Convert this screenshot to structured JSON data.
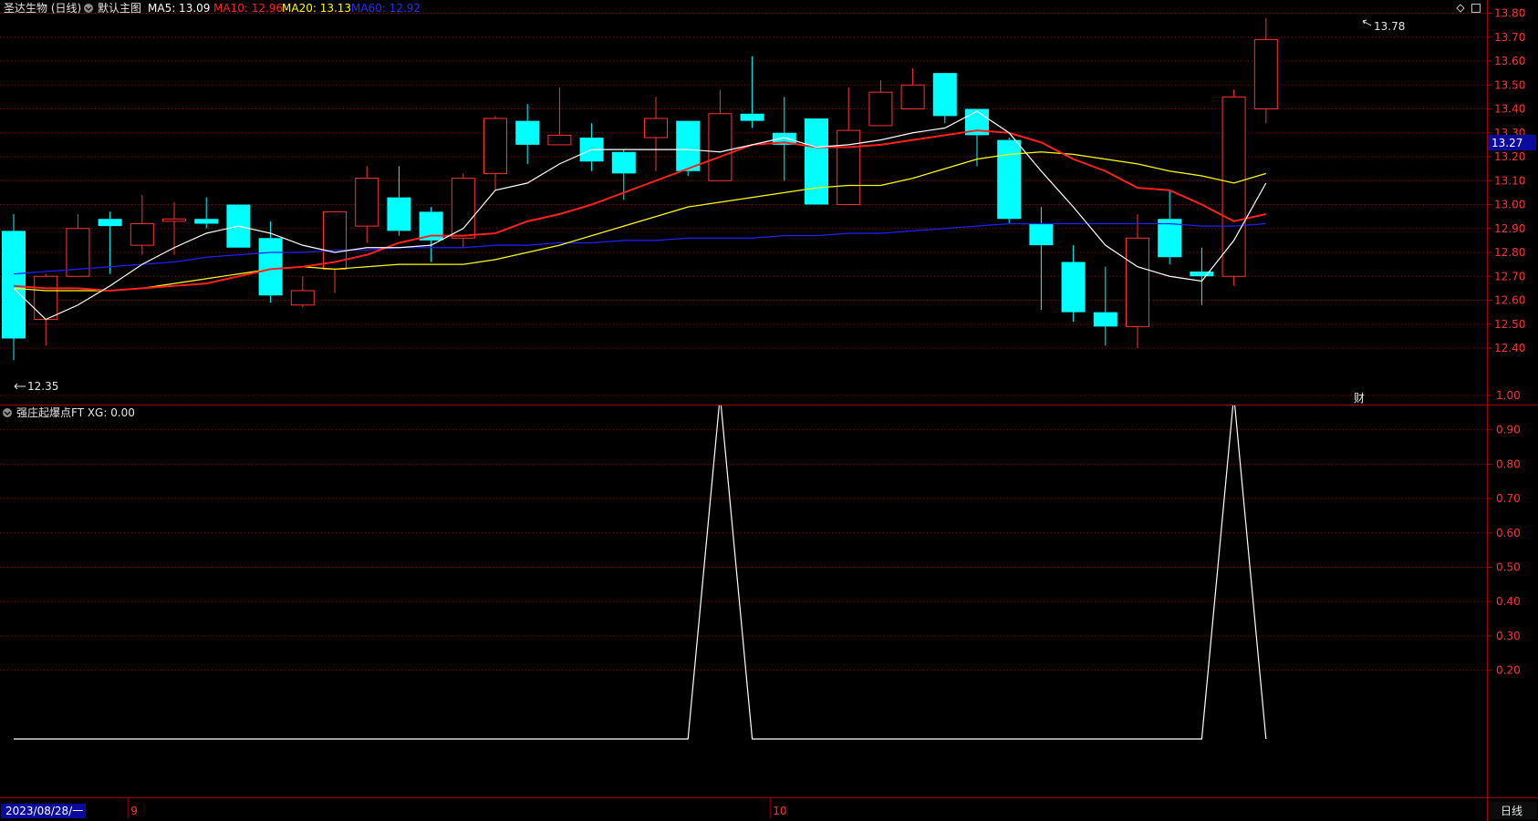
{
  "header": {
    "stock_name": "圣达生物 (日线)",
    "template_label": "默认主图",
    "ma5": {
      "label": "MA5: 13.09",
      "color": "#ffffff"
    },
    "ma10": {
      "label": "MA10: 12.96",
      "color": "#ff2020"
    },
    "ma20": {
      "label": "MA20: 13.13",
      "color": "#ffff00"
    },
    "ma60": {
      "label": "MA60: 12.92",
      "color": "#2020ff"
    }
  },
  "price_axis": {
    "ticks": [
      "13.80",
      "13.70",
      "13.60",
      "13.50",
      "13.40",
      "13.30",
      "13.20",
      "13.10",
      "13.00",
      "12.90",
      "12.80",
      "12.70",
      "12.60",
      "12.50",
      "12.40"
    ],
    "current_price": "13.27",
    "high_label": "13.78",
    "low_label": "12.35",
    "finance_marker": "财"
  },
  "indicator": {
    "title": "强庄起爆点FT  XG: 0.00",
    "ticks": [
      "1.00",
      "0.90",
      "0.80",
      "0.70",
      "0.60",
      "0.50",
      "0.40",
      "0.30",
      "0.20"
    ],
    "values": [
      0,
      0,
      0,
      0,
      0,
      0,
      0,
      0,
      0,
      0,
      0,
      0,
      0,
      0,
      0,
      0,
      0,
      0,
      0,
      0,
      0,
      0,
      1,
      0,
      0,
      0,
      0,
      0,
      0,
      0,
      0,
      0,
      0,
      0,
      0,
      0,
      0,
      0,
      1,
      0
    ]
  },
  "time_axis": {
    "start_date": "2023/08/28/一",
    "month_labels": [
      {
        "index": 4,
        "label": "9"
      },
      {
        "index": 24,
        "label": "10"
      }
    ],
    "period": "日线"
  },
  "colors": {
    "up": "#ff3232",
    "down": "#00ffff",
    "grid": "#7a1010",
    "axis": "#a00000"
  },
  "chart_data": {
    "type": "candlestick",
    "candles": [
      {
        "o": 12.89,
        "h": 12.96,
        "l": 12.35,
        "c": 12.44
      },
      {
        "o": 12.52,
        "h": 12.71,
        "l": 12.41,
        "c": 12.7
      },
      {
        "o": 12.7,
        "h": 12.96,
        "l": 12.7,
        "c": 12.9
      },
      {
        "o": 12.94,
        "h": 12.97,
        "l": 12.71,
        "c": 12.91
      },
      {
        "o": 12.83,
        "h": 13.04,
        "l": 12.79,
        "c": 12.92
      },
      {
        "o": 12.93,
        "h": 13.01,
        "l": 12.79,
        "c": 12.94
      },
      {
        "o": 12.94,
        "h": 13.03,
        "l": 12.9,
        "c": 12.92
      },
      {
        "o": 13.0,
        "h": 13.0,
        "l": 12.82,
        "c": 12.82
      },
      {
        "o": 12.86,
        "h": 12.93,
        "l": 12.59,
        "c": 12.62
      },
      {
        "o": 12.58,
        "h": 12.7,
        "l": 12.57,
        "c": 12.64
      },
      {
        "o": 12.73,
        "h": 12.97,
        "l": 12.63,
        "c": 12.97
      },
      {
        "o": 12.91,
        "h": 13.16,
        "l": 12.84,
        "c": 13.11
      },
      {
        "o": 13.03,
        "h": 13.16,
        "l": 12.87,
        "c": 12.89
      },
      {
        "o": 12.97,
        "h": 12.99,
        "l": 12.76,
        "c": 12.85
      },
      {
        "o": 12.86,
        "h": 13.13,
        "l": 12.82,
        "c": 13.11
      },
      {
        "o": 13.13,
        "h": 13.37,
        "l": 13.06,
        "c": 13.36
      },
      {
        "o": 13.35,
        "h": 13.42,
        "l": 13.17,
        "c": 13.25
      },
      {
        "o": 13.25,
        "h": 13.49,
        "l": 13.25,
        "c": 13.29
      },
      {
        "o": 13.28,
        "h": 13.34,
        "l": 13.14,
        "c": 13.18
      },
      {
        "o": 13.22,
        "h": 13.23,
        "l": 13.02,
        "c": 13.13
      },
      {
        "o": 13.28,
        "h": 13.45,
        "l": 13.14,
        "c": 13.36
      },
      {
        "o": 13.35,
        "h": 13.35,
        "l": 13.12,
        "c": 13.14
      },
      {
        "o": 13.1,
        "h": 13.48,
        "l": 13.1,
        "c": 13.38
      },
      {
        "o": 13.38,
        "h": 13.62,
        "l": 13.32,
        "c": 13.35
      },
      {
        "o": 13.3,
        "h": 13.45,
        "l": 13.1,
        "c": 13.25
      },
      {
        "o": 13.36,
        "h": 13.36,
        "l": 13.0,
        "c": 13.0
      },
      {
        "o": 13.0,
        "h": 13.49,
        "l": 13.0,
        "c": 13.31
      },
      {
        "o": 13.33,
        "h": 13.52,
        "l": 13.33,
        "c": 13.47
      },
      {
        "o": 13.4,
        "h": 13.57,
        "l": 13.4,
        "c": 13.5
      },
      {
        "o": 13.55,
        "h": 13.55,
        "l": 13.34,
        "c": 13.37
      },
      {
        "o": 13.4,
        "h": 13.4,
        "l": 13.16,
        "c": 13.29
      },
      {
        "o": 13.27,
        "h": 13.28,
        "l": 12.92,
        "c": 12.94
      },
      {
        "o": 12.92,
        "h": 12.99,
        "l": 12.56,
        "c": 12.83
      },
      {
        "o": 12.76,
        "h": 12.83,
        "l": 12.51,
        "c": 12.55
      },
      {
        "o": 12.55,
        "h": 12.74,
        "l": 12.41,
        "c": 12.49
      },
      {
        "o": 12.49,
        "h": 12.96,
        "l": 12.4,
        "c": 12.86
      },
      {
        "o": 12.94,
        "h": 13.06,
        "l": 12.75,
        "c": 12.78
      },
      {
        "o": 12.72,
        "h": 12.82,
        "l": 12.58,
        "c": 12.7
      },
      {
        "o": 12.7,
        "h": 13.48,
        "l": 12.66,
        "c": 13.45
      },
      {
        "o": 13.4,
        "h": 13.78,
        "l": 13.34,
        "c": 13.69
      }
    ],
    "ma5": [
      12.65,
      12.52,
      12.58,
      12.66,
      12.75,
      12.82,
      12.88,
      12.91,
      12.88,
      12.83,
      12.8,
      12.82,
      12.82,
      12.83,
      12.9,
      13.06,
      13.09,
      13.17,
      13.23,
      13.23,
      13.23,
      13.23,
      13.22,
      13.25,
      13.28,
      13.24,
      13.25,
      13.27,
      13.3,
      13.32,
      13.39,
      13.3,
      13.14,
      12.99,
      12.83,
      12.74,
      12.7,
      12.68,
      12.85,
      13.09
    ],
    "ma10": [
      12.66,
      12.65,
      12.65,
      12.64,
      12.65,
      12.66,
      12.67,
      12.7,
      12.73,
      12.74,
      12.76,
      12.79,
      12.84,
      12.87,
      12.87,
      12.88,
      12.93,
      12.96,
      13.0,
      13.05,
      13.1,
      13.15,
      13.2,
      13.25,
      13.26,
      13.24,
      13.24,
      13.25,
      13.27,
      13.29,
      13.31,
      13.3,
      13.26,
      13.19,
      13.14,
      13.07,
      13.06,
      13.0,
      12.93,
      12.96
    ],
    "ma20": [
      12.65,
      12.64,
      12.64,
      12.64,
      12.65,
      12.67,
      12.69,
      12.71,
      12.73,
      12.74,
      12.73,
      12.74,
      12.75,
      12.75,
      12.75,
      12.77,
      12.8,
      12.83,
      12.87,
      12.91,
      12.95,
      12.99,
      13.01,
      13.03,
      13.05,
      13.07,
      13.08,
      13.08,
      13.11,
      13.15,
      13.19,
      13.21,
      13.22,
      13.21,
      13.19,
      13.17,
      13.14,
      13.12,
      13.09,
      13.13
    ],
    "ma60": [
      12.71,
      12.72,
      12.73,
      12.74,
      12.75,
      12.76,
      12.78,
      12.79,
      12.8,
      12.8,
      12.81,
      12.81,
      12.82,
      12.82,
      12.82,
      12.83,
      12.83,
      12.84,
      12.84,
      12.85,
      12.85,
      12.86,
      12.86,
      12.86,
      12.87,
      12.87,
      12.88,
      12.88,
      12.89,
      12.9,
      12.91,
      12.92,
      12.92,
      12.92,
      12.92,
      12.92,
      12.92,
      12.91,
      12.91,
      12.92
    ]
  }
}
